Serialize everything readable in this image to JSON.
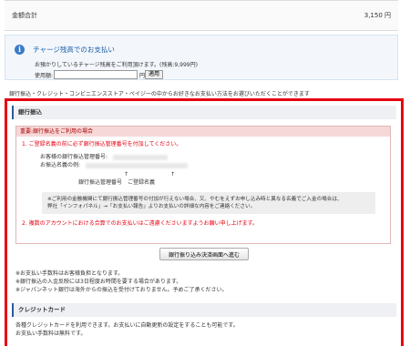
{
  "total": {
    "label": "金額合計",
    "amount": "3,150 円"
  },
  "charge": {
    "title": "チャージ残高でのお支払い",
    "description": "お預かりしているチャージ残高をご利用頂けます。(残高:9,999円)",
    "use_label": "使用額:",
    "yen_suffix": "円",
    "apply_button": "適用",
    "input_value": ""
  },
  "intro_text": "銀行振込・クレジット・コンビニエンスストア・ペイジーの中からお好きなお支払い方法をお選びいただくことができます",
  "bank": {
    "section_title": "銀行振込",
    "panel_title": "重要:銀行振込をご利用の場合",
    "item1": "1. ご登録名義の前に必ず銀行振込管理番号を付加してください。",
    "ref_number_label": "お客様の銀行振込管理番号:",
    "ref_name_label": "お振込名義の例:",
    "arrow1": "↑",
    "arrow2": "↑",
    "label_ref": "銀行振込管理番号",
    "label_name": "ご登録名義",
    "note_line1": "※ご利用の金融機関にて銀行振込管理番号の付加が行えない場合、又、やむをえずお申し込み時と異なる名義でご入金の場合は、",
    "note_line2": "弊社「インフォパネル」→「お支払い報告」よりお支払いの詳細な内容をご連絡ください。",
    "item2": "2. 複数のアカウントにおける合算でのお支払いはご遠慮くださいますようお願い申し上げます。",
    "proceed_button": "銀行振り込み決済画面へ進む",
    "notes": [
      "※お支払い手数料はお客様負担となります。",
      "※銀行振込の入金反映には3日程度お時間を要する場合があります。",
      "※ジャパンネット銀行は海外からの振込を受付けておりません。予めご了承ください。"
    ]
  },
  "card": {
    "section_title": "クレジットカード",
    "line1": "各種クレジットカードを利用できます。お支払いに自動更新の設定をすることも可能です。",
    "line2": "お支払い手数料は無料です。"
  },
  "colors": {
    "highlight_frame": "#e60012",
    "link_blue": "#1a5fa8",
    "info_icon": "#3b7bc8"
  },
  "icons": {
    "charge": "info-icon"
  }
}
